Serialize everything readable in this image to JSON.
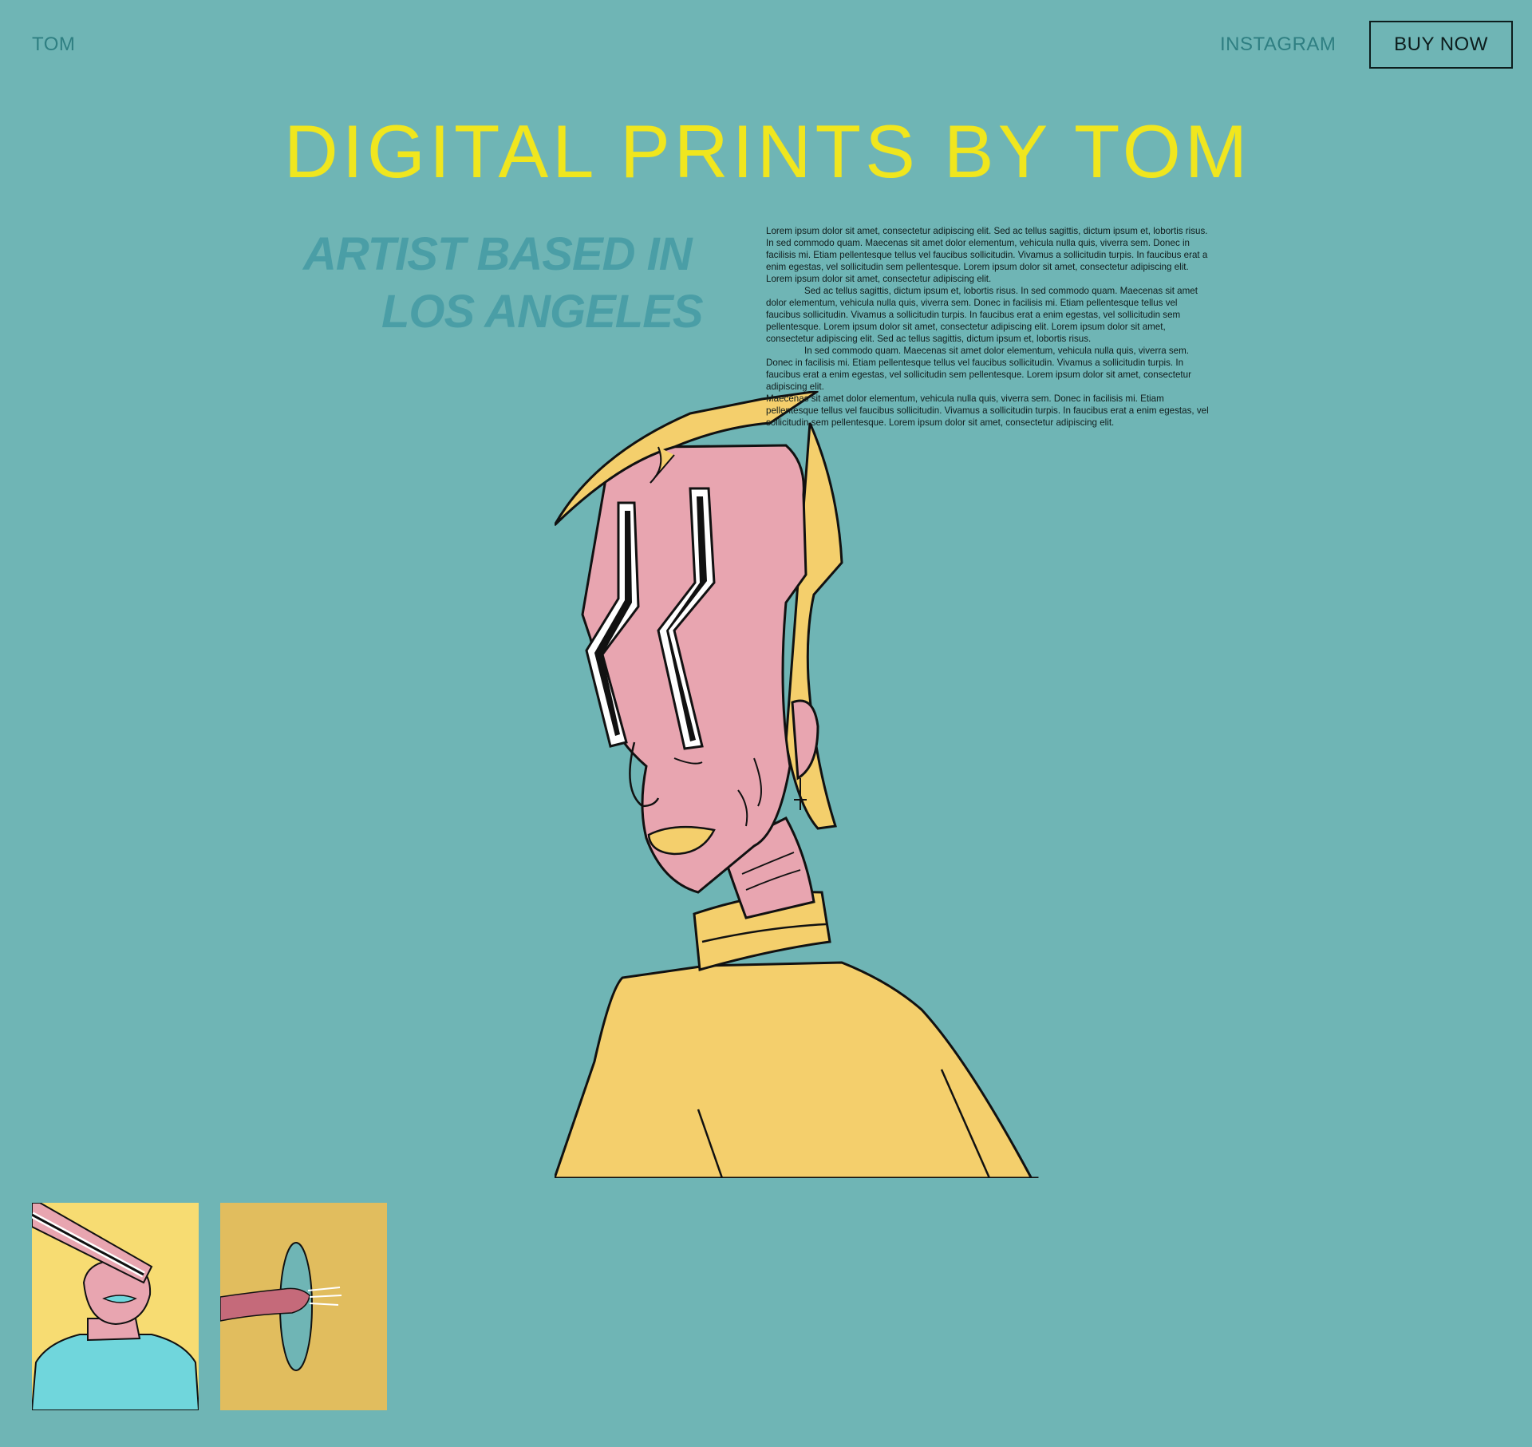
{
  "nav": {
    "brand": "TOM",
    "instagram": "INSTAGRAM",
    "buy_now": "BUY NOW"
  },
  "hero": {
    "title": "DIGITAL PRINTS BY TOM",
    "tagline_line1": "ARTIST BASED IN",
    "tagline_line2": "LOS ANGELES"
  },
  "bio": {
    "p1": "Lorem ipsum dolor sit amet, consectetur adipiscing elit. Sed ac tellus sagittis, dictum ipsum et, lobortis risus. In sed commodo quam. Maecenas sit amet dolor elementum, vehicula nulla quis, viverra sem. Donec in facilisis mi. Etiam pellentesque tellus vel faucibus sollicitudin. Vivamus a sollicitudin turpis. In faucibus erat a enim egestas, vel sollicitudin sem pellentesque. Lorem ipsum dolor sit amet, consectetur adipiscing elit. Lorem ipsum dolor sit amet, consectetur adipiscing elit.",
    "p2": "Sed ac tellus sagittis, dictum ipsum et, lobortis risus. In sed commodo quam. Maecenas sit amet dolor elementum, vehicula nulla quis, viverra sem. Donec in facilisis mi. Etiam pellentesque tellus vel faucibus sollicitudin. Vivamus a sollicitudin turpis. In faucibus erat a enim egestas, vel sollicitudin sem pellentesque. Lorem ipsum dolor sit amet, consectetur adipiscing elit. Lorem ipsum dolor sit amet, consectetur adipiscing elit. Sed ac tellus sagittis, dictum ipsum et, lobortis risus.",
    "p3": "In sed commodo quam. Maecenas sit amet dolor elementum, vehicula nulla quis, viverra sem. Donec in facilisis mi. Etiam pellentesque tellus vel faucibus sollicitudin. Vivamus a sollicitudin turpis. In faucibus erat a enim egestas, vel sollicitudin sem pellentesque. Lorem ipsum dolor sit amet, consectetur adipiscing elit.",
    "p4": "Maecenas sit amet dolor elementum, vehicula nulla quis, viverra sem. Donec in facilisis mi. Etiam pellentesque tellus vel faucibus sollicitudin. Vivamus a sollicitudin turpis. In faucibus erat a enim egestas, vel sollicitudin sem pellentesque. Lorem ipsum dolor sit amet, consectetur adipiscing elit."
  },
  "colors": {
    "background": "#6fb5b5",
    "title_yellow": "#f0e61e",
    "tagline_teal": "#4a9ea6",
    "nav_teal": "#2f7f82",
    "skin_pink": "#e8a5b0",
    "hair_yellow": "#f4cf6c",
    "thumb1_bg": "#f7dc72",
    "thumb2_bg": "#e1bd5e"
  },
  "gallery": {
    "items": [
      {
        "name": "print-pink-beam-face"
      },
      {
        "name": "print-fist-through-portal"
      }
    ]
  }
}
